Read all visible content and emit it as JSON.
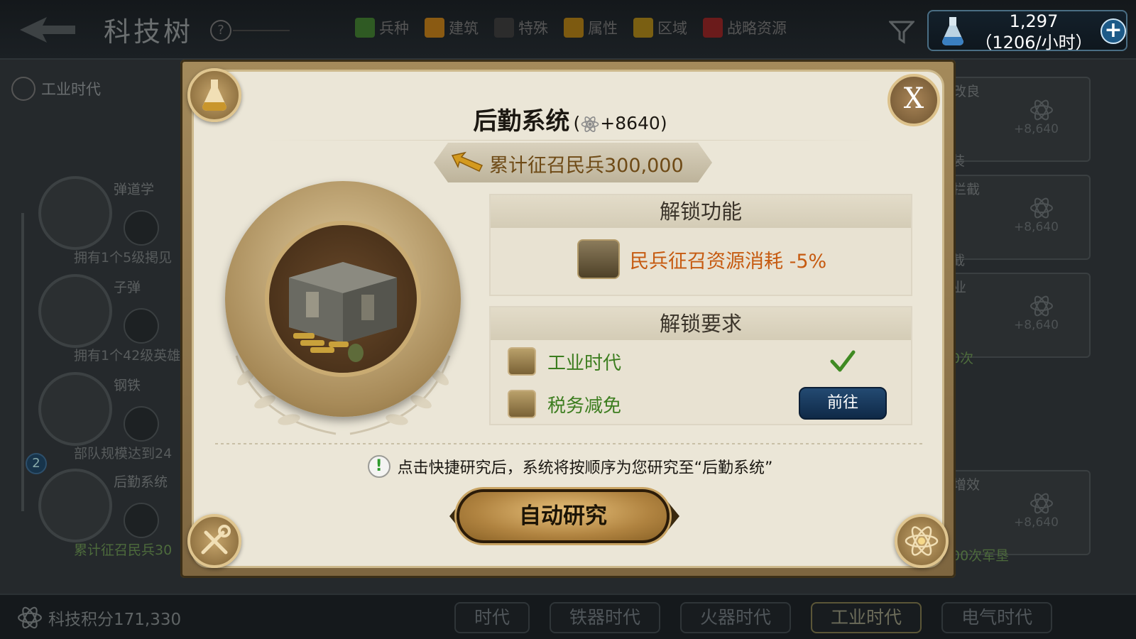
{
  "header": {
    "title": "科技树",
    "help_symbol": "?",
    "filter_tabs": [
      {
        "label": "兵种",
        "color": "#2f5a23"
      },
      {
        "label": "建筑",
        "color": "#8a5a12"
      },
      {
        "label": "特殊",
        "color": "#2c2c2c"
      },
      {
        "label": "属性",
        "color": "#7d5a10"
      },
      {
        "label": "区域",
        "color": "#7a5f12"
      },
      {
        "label": "战略资源",
        "color": "#6b1b1b"
      }
    ],
    "resource": {
      "amount": "1,297",
      "rate": "（1206/小时）"
    }
  },
  "tree": {
    "era_label": "工业时代",
    "nodes": [
      {
        "name": "弹道学",
        "condition": "拥有1个5级掲见"
      },
      {
        "name": "子弹",
        "condition": "拥有1个42级英雄"
      },
      {
        "name": "钢铁",
        "condition": "部队规模达到24"
      },
      {
        "name": "后勤系统",
        "condition": "累计征召民兵30"
      }
    ],
    "node_badge": "2",
    "right_cards": [
      {
        "title": "改良",
        "value": "+8,640"
      },
      {
        "title": "拦截",
        "value": "+8,640"
      },
      {
        "title": "业",
        "value": "+8,640"
      },
      {
        "title": "增效",
        "value": "+8,640"
      }
    ],
    "right_fragments": [
      "装",
      "截",
      "0次",
      "00次军垦"
    ]
  },
  "footer": {
    "science_points": "科技积分171,330",
    "era_tabs": [
      "时代",
      "铁器时代",
      "火器时代",
      "工业时代",
      "电气时代"
    ],
    "active_era": "工业时代"
  },
  "modal": {
    "tech_name": "后勤系统",
    "bonus": "+8640",
    "close_label": "X",
    "unlock_condition": "累计征召民兵300,000",
    "unlock_function": {
      "title": "解锁功能",
      "effect": "民兵征召资源消耗 -5%"
    },
    "unlock_requirements": {
      "title": "解锁要求",
      "items": [
        {
          "label": "工业时代",
          "status": "met"
        },
        {
          "label": "税务减免",
          "status": "unmet",
          "action": "前往"
        }
      ]
    },
    "tip": "点击快捷研究后，系统将按顺序为您研究至“后勤系统”",
    "auto_research_label": "自动研究"
  },
  "colors": {
    "requirement_text": "#3c7d1f",
    "effect_text": "#c65a10",
    "condition_text": "#6e4a16",
    "goto_button": "#163a60"
  }
}
